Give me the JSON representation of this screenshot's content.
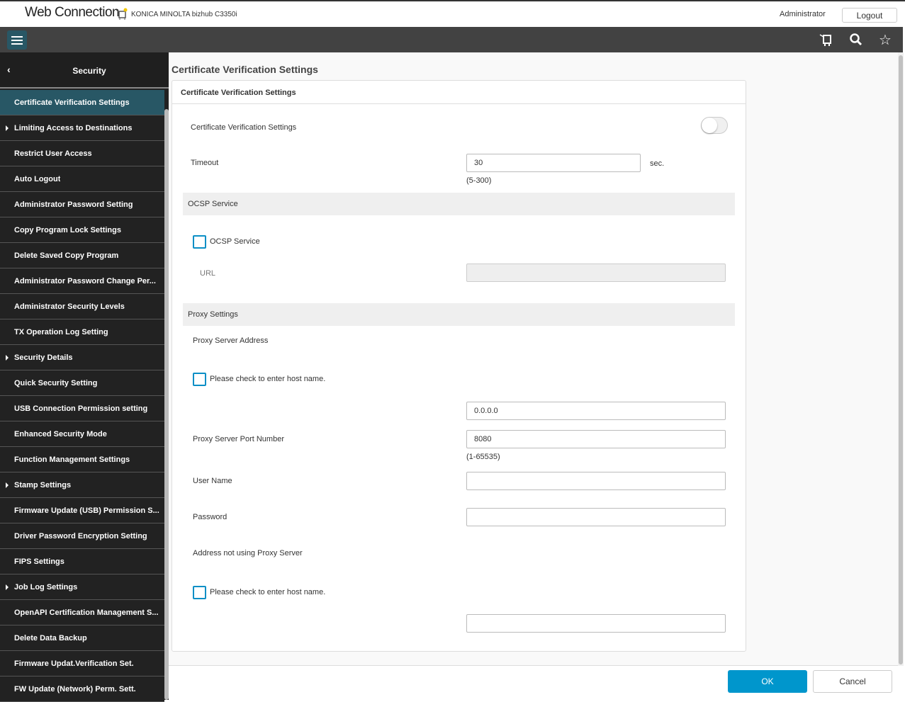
{
  "header": {
    "logo": "Web Connection",
    "device": "KONICA MINOLTA bizhub C3350i",
    "user": "Administrator",
    "logout": "Logout"
  },
  "navbar": {
    "icons": [
      "menu-icon",
      "device-icon",
      "search-icon",
      "star-icon"
    ]
  },
  "sidebar": {
    "title": "Security",
    "items": [
      {
        "label": "Certificate Verification Settings",
        "active": true,
        "expandable": false
      },
      {
        "label": "Limiting Access to Destinations",
        "expandable": true
      },
      {
        "label": "Restrict User Access"
      },
      {
        "label": "Auto Logout"
      },
      {
        "label": "Administrator Password Setting"
      },
      {
        "label": "Copy Program Lock Settings"
      },
      {
        "label": "Delete Saved Copy Program"
      },
      {
        "label": "Administrator Password Change Per..."
      },
      {
        "label": "Administrator Security Levels"
      },
      {
        "label": "TX Operation Log Setting"
      },
      {
        "label": "Security Details",
        "expandable": true
      },
      {
        "label": "Quick Security Setting"
      },
      {
        "label": "USB Connection Permission setting"
      },
      {
        "label": "Enhanced Security Mode"
      },
      {
        "label": "Function Management Settings"
      },
      {
        "label": "Stamp Settings",
        "expandable": true
      },
      {
        "label": "Firmware Update (USB) Permission S..."
      },
      {
        "label": "Driver Password Encryption Setting"
      },
      {
        "label": "FIPS Settings"
      },
      {
        "label": "Job Log Settings",
        "expandable": true
      },
      {
        "label": "OpenAPI Certification Management S..."
      },
      {
        "label": "Delete Data Backup"
      },
      {
        "label": "Firmware Updat.Verification Set."
      },
      {
        "label": "FW Update (Network) Perm. Sett."
      }
    ]
  },
  "main": {
    "page_title": "Certificate Verification Settings",
    "panel_title": "Certificate Verification Settings",
    "cert_label": "Certificate Verification Settings",
    "cert_enabled": false,
    "timeout_label": "Timeout",
    "timeout_value": "30",
    "timeout_unit": "sec.",
    "timeout_range": "(5-300)",
    "ocsp_section": "OCSP Service",
    "ocsp_checkbox": "OCSP Service",
    "ocsp_checked": false,
    "url_label": "URL",
    "url_value": "",
    "proxy_section": "Proxy Settings",
    "proxy_addr_label": "Proxy Server Address",
    "hostname_checkbox": "Please check to enter host name.",
    "proxy_addr_value": "0.0.0.0",
    "proxy_port_label": "Proxy Server Port Number",
    "proxy_port_value": "8080",
    "proxy_port_range": "(1-65535)",
    "username_label": "User Name",
    "username_value": "",
    "password_label": "Password",
    "password_value": "",
    "no_proxy_label": "Address not using Proxy Server",
    "no_proxy_checkbox": "Please check to enter host name.",
    "no_proxy_value": ""
  },
  "footer": {
    "ok": "OK",
    "cancel": "Cancel"
  },
  "colors": {
    "accent": "#0096cc",
    "sidebar_active": "#285765",
    "navbar": "#424242"
  }
}
